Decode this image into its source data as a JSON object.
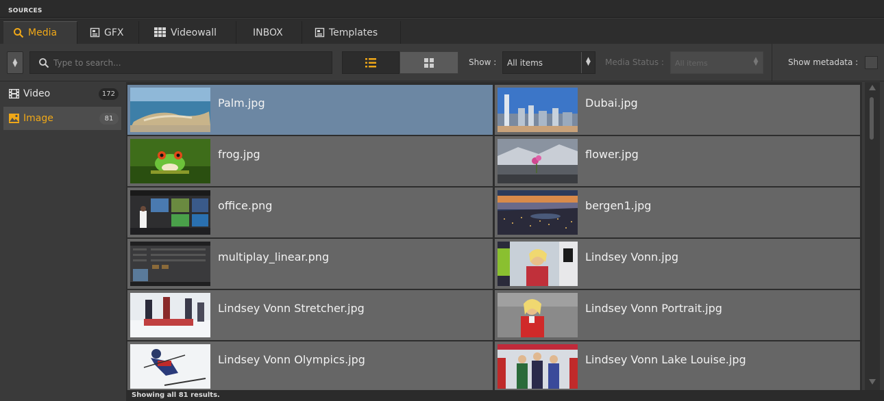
{
  "section": {
    "title": "SOURCES"
  },
  "tabs": [
    {
      "label": "Media",
      "icon": "search-icon",
      "active": true
    },
    {
      "label": "GFX",
      "icon": "gfx-icon"
    },
    {
      "label": "Videowall",
      "icon": "videowall-icon"
    },
    {
      "label": "INBOX"
    },
    {
      "label": "Templates",
      "icon": "template-icon"
    }
  ],
  "toolbar": {
    "search_placeholder": "Type to search...",
    "show_label": "Show :",
    "show_value": "All items",
    "media_status_label": "Media Status :",
    "media_status_value": "All items",
    "show_metadata_label": "Show metadata :"
  },
  "sidebar": {
    "items": [
      {
        "label": "Video",
        "count": "172",
        "icon": "film-icon"
      },
      {
        "label": "Image",
        "count": "81",
        "icon": "image-icon",
        "active": true
      }
    ]
  },
  "items": [
    {
      "name": "Palm.jpg",
      "selected": true
    },
    {
      "name": "Dubai.jpg"
    },
    {
      "name": "frog.jpg"
    },
    {
      "name": "flower.jpg"
    },
    {
      "name": "office.png"
    },
    {
      "name": "bergen1.jpg"
    },
    {
      "name": "multiplay_linear.png"
    },
    {
      "name": "Lindsey Vonn.jpg"
    },
    {
      "name": "Lindsey Vonn Stretcher.jpg"
    },
    {
      "name": "Lindsey Vonn Portrait.jpg"
    },
    {
      "name": "Lindsey Vonn Olympics.jpg"
    },
    {
      "name": "Lindsey Vonn Lake Louise.jpg"
    }
  ],
  "status": {
    "text": "Showing all 81 results."
  },
  "colors": {
    "accent": "#f0a818",
    "selected_row": "#6c87a3",
    "tile": "#666666"
  }
}
